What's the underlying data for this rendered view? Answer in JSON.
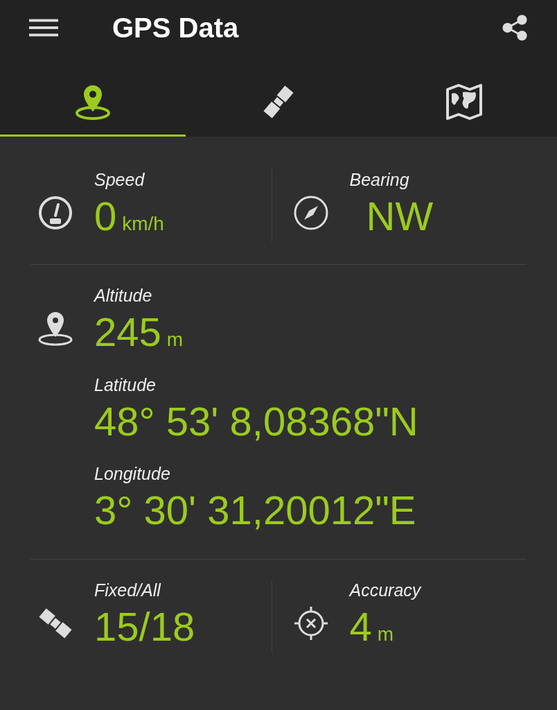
{
  "app_bar": {
    "title": "GPS Data"
  },
  "tabs": [
    {
      "kind": "location",
      "selected": true
    },
    {
      "kind": "satellite",
      "selected": false
    },
    {
      "kind": "map",
      "selected": false
    }
  ],
  "rows": [
    {
      "cells": [
        {
          "kind": "gauge",
          "fields": [
            {
              "label": "Speed",
              "value": "0",
              "unit": "km/h"
            }
          ]
        },
        {
          "kind": "compass",
          "fields": [
            {
              "label": "Bearing",
              "value": "NW"
            }
          ]
        }
      ]
    },
    {
      "cells": [
        {
          "kind": "location",
          "fields": [
            {
              "label": "Altitude",
              "value": "245",
              "unit": "m"
            },
            {
              "label": "Latitude",
              "value": "48° 53' 8,08368\"N"
            },
            {
              "label": "Longitude",
              "value": "3° 30' 31,20012\"E"
            }
          ]
        }
      ]
    },
    {
      "cells": [
        {
          "kind": "satellite",
          "fields": [
            {
              "label": "Fixed/All",
              "value": "15/18"
            }
          ]
        },
        {
          "kind": "crosshair",
          "fields": [
            {
              "label": "Accuracy",
              "value": "4",
              "unit": "m"
            }
          ]
        }
      ]
    }
  ]
}
